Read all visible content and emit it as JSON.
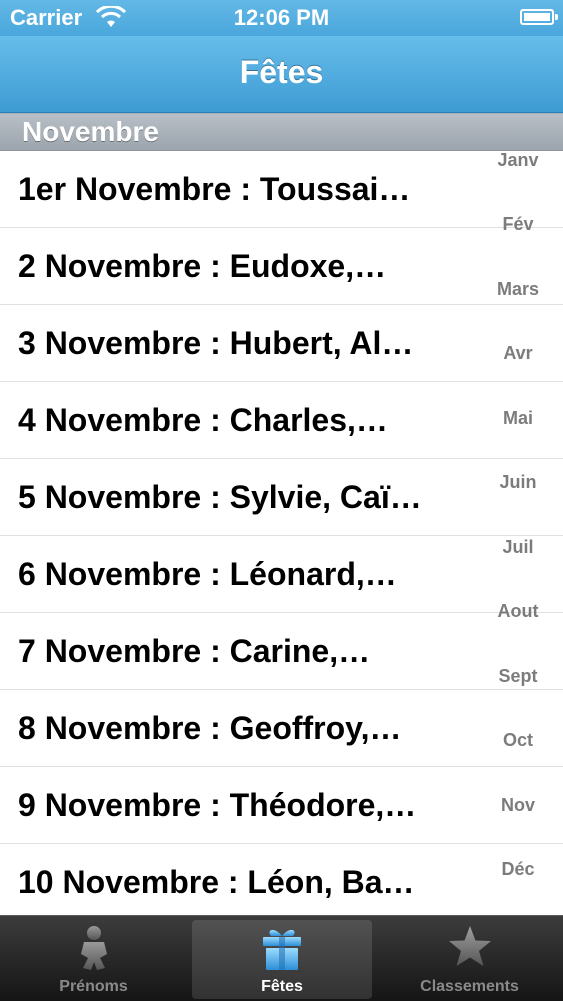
{
  "status_bar": {
    "carrier": "Carrier",
    "time": "12:06 PM"
  },
  "nav": {
    "title": "Fêtes"
  },
  "section": {
    "title": "Novembre"
  },
  "rows": [
    "1er Novembre : Toussai…",
    "2 Novembre : Eudoxe,…",
    "3 Novembre : Hubert, Al…",
    "4 Novembre : Charles,…",
    "5 Novembre : Sylvie, Caï…",
    "6 Novembre : Léonard,…",
    "7 Novembre : Carine,…",
    "8 Novembre : Geoffroy,…",
    "9 Novembre : Théodore,…",
    "10 Novembre : Léon, Ba…"
  ],
  "index": [
    "Janv",
    "Fév",
    "Mars",
    "Avr",
    "Mai",
    "Juin",
    "Juil",
    "Aout",
    "Sept",
    "Oct",
    "Nov",
    "Déc"
  ],
  "tabs": [
    {
      "label": "Prénoms",
      "icon": "baby-icon",
      "active": false
    },
    {
      "label": "Fêtes",
      "icon": "gift-icon",
      "active": true
    },
    {
      "label": "Classements",
      "icon": "star-icon",
      "active": false
    }
  ]
}
